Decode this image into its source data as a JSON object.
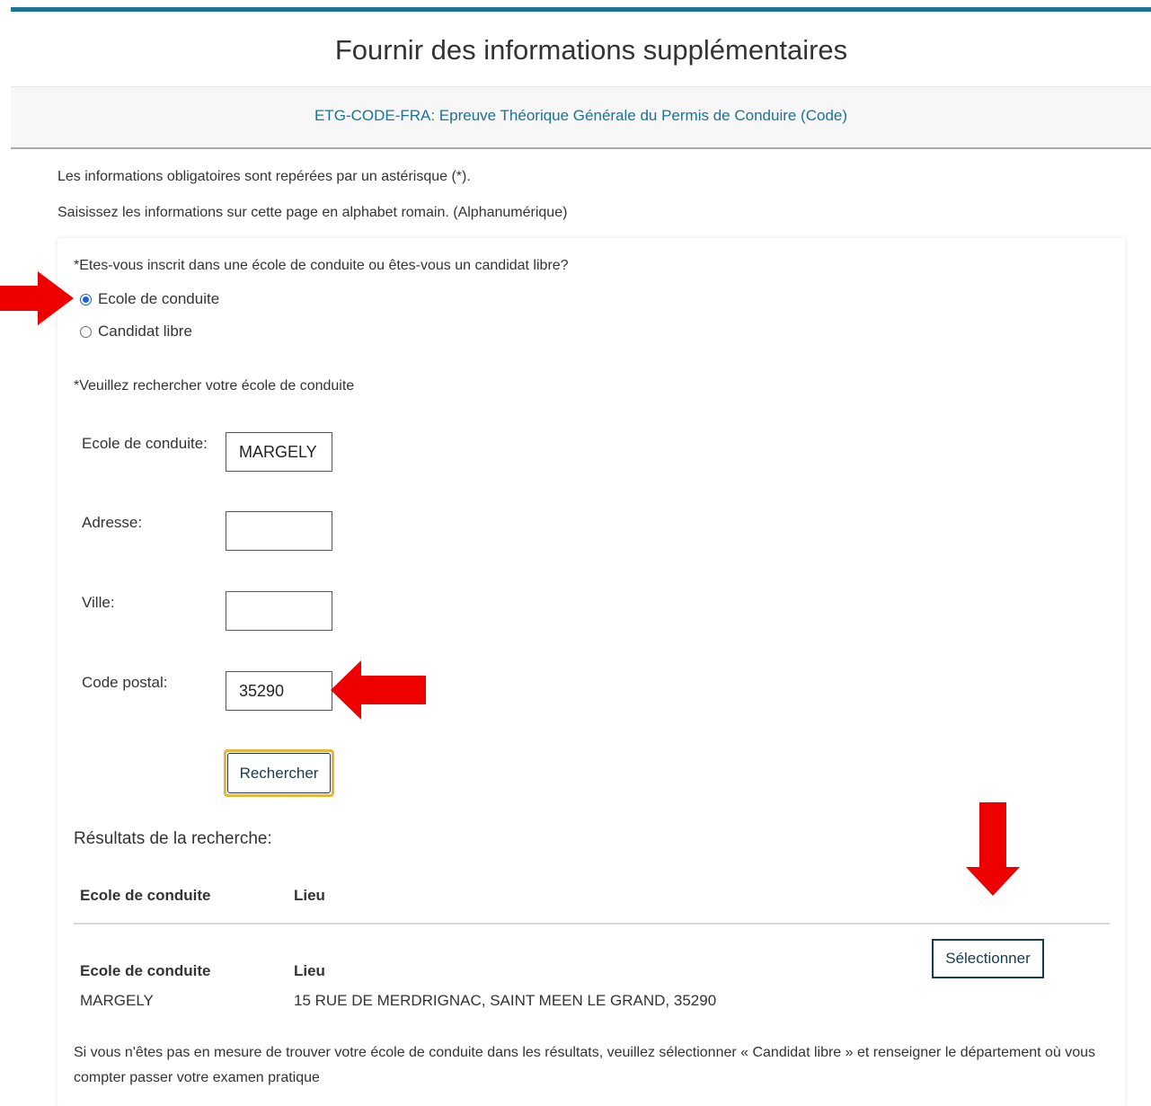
{
  "header": {
    "title": "Fournir des informations supplémentaires",
    "exam_link": "ETG-CODE-FRA: Epreuve Théorique Générale du Permis de Conduire (Code)"
  },
  "info": {
    "mandatory_note": "Les informations obligatoires sont repérées par un astérisque (*).",
    "alphabet_note": "Saisissez les informations sur cette page en alphabet romain. (Alphanumérique)"
  },
  "form": {
    "question": "*Etes-vous inscrit dans une école de conduite ou êtes-vous un candidat libre?",
    "options": [
      {
        "label": "Ecole de conduite",
        "selected": true
      },
      {
        "label": "Candidat libre",
        "selected": false
      }
    ],
    "search_prompt": "*Veuillez rechercher votre école de conduite",
    "fields": {
      "school": {
        "label": "Ecole de conduite:",
        "value": "MARGELY"
      },
      "address": {
        "label": "Adresse:",
        "value": ""
      },
      "city": {
        "label": "Ville:",
        "value": ""
      },
      "postal": {
        "label": "Code postal:",
        "value": "35290"
      }
    },
    "search_button": "Rechercher"
  },
  "results": {
    "title": "Résultats de la recherche:",
    "columns": [
      "Ecole de conduite",
      "Lieu"
    ],
    "rows": [
      {
        "school": "MARGELY",
        "place": "15 RUE DE MERDRIGNAC, SAINT MEEN LE GRAND, 35290",
        "button": "Sélectionner"
      }
    ],
    "note": "Si vous n'êtes pas en mesure de trouver votre école de conduite dans les résultats, veuillez sélectionner « Candidat libre » et renseigner le département où vous compter passer votre examen pratique"
  },
  "colors": {
    "accent": "#1a7395",
    "button_text": "#123c54",
    "focus_ring": "#e5b63a",
    "annotation_arrow": "#ee0000"
  }
}
